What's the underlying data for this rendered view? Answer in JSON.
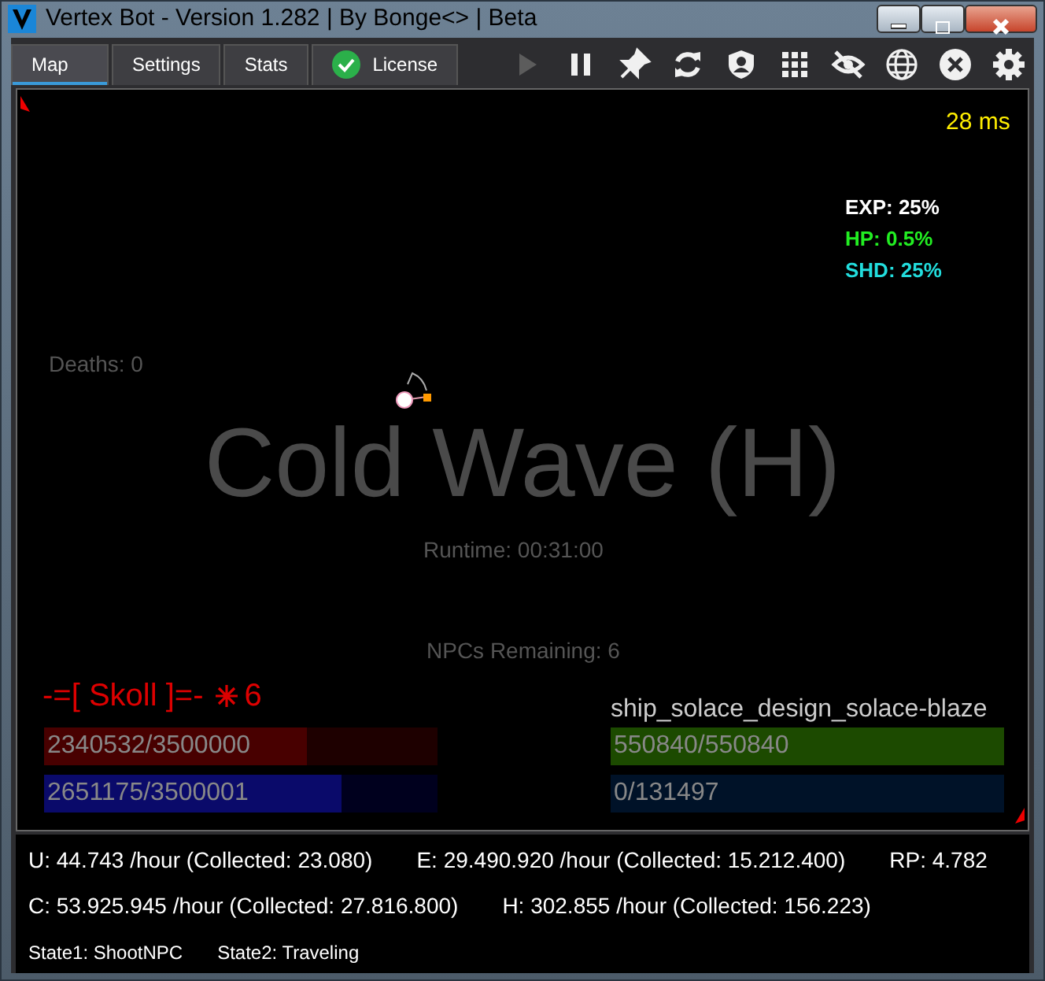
{
  "window": {
    "title": "Vertex Bot - Version 1.282 | By Bonge<> | Beta"
  },
  "tabs": [
    {
      "label": "Map",
      "selected": true,
      "checked": false
    },
    {
      "label": "Settings",
      "selected": false,
      "checked": false
    },
    {
      "label": "Stats",
      "selected": false,
      "checked": false
    },
    {
      "label": "License",
      "selected": false,
      "checked": true
    }
  ],
  "toolbar": [
    {
      "kind": "play",
      "disabled": true
    },
    {
      "kind": "pause",
      "disabled": false
    },
    {
      "kind": "pin",
      "disabled": false
    },
    {
      "kind": "refresh",
      "disabled": false
    },
    {
      "kind": "shield",
      "disabled": false
    },
    {
      "kind": "grid",
      "disabled": false
    },
    {
      "kind": "hide",
      "disabled": false
    },
    {
      "kind": "globe",
      "disabled": false
    },
    {
      "kind": "close",
      "disabled": false
    },
    {
      "kind": "settings",
      "disabled": false
    }
  ],
  "map": {
    "ping": "28 ms",
    "exp": "EXP: 25%",
    "hp": "HP: 0.5%",
    "shd": "SHD: 25%",
    "deaths": "Deaths: 0",
    "map_name": "Cold Wave (H)",
    "runtime": "Runtime: 00:31:00",
    "npcs_remaining": "NPCs Remaining: 6",
    "target": {
      "name": "-=[ Skoll ]=-",
      "count": "6",
      "hp": {
        "reading": "2340532/3500000",
        "level": 0.669
      },
      "shield": {
        "reading": "2651175/3500001",
        "level": 0.757
      }
    },
    "ship": {
      "name": "ship_solace_design_solace-blaze",
      "hp": {
        "reading": "550840/550840",
        "level": 1.0
      },
      "shield": {
        "reading": "0/131497",
        "level": 0.0
      }
    }
  },
  "stats": [
    [
      "U: 44.743 /hour (Collected: 23.080)",
      "E: 29.490.920 /hour (Collected: 15.212.400)",
      "RP: 4.782"
    ],
    [
      "C: 53.925.945 /hour (Collected: 27.816.800)",
      "H: 302.855 /hour (Collected: 156.223)"
    ]
  ],
  "status": [
    "State1: ShootNPC",
    "State2: Traveling"
  ]
}
